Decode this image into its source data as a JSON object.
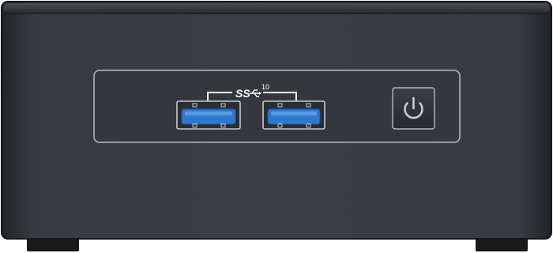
{
  "device": {
    "usb_label": {
      "prefix": "SS",
      "speed": "10"
    },
    "usb_port_count": 2,
    "power_button_icon": "power-icon",
    "colors": {
      "chassis": "#34383d",
      "chassis_dark": "#1f2226",
      "panel_border": "#9aa0a6",
      "usb_blue": "#2f78d0",
      "usb_blue_dark": "#1a56a8",
      "label": "#ffffff",
      "feet": "#18191b"
    }
  }
}
